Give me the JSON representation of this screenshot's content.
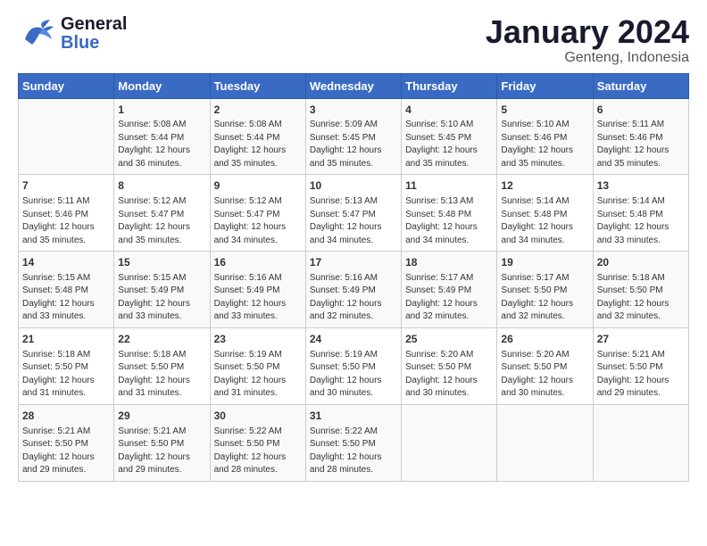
{
  "header": {
    "logo_general": "General",
    "logo_blue": "Blue",
    "title": "January 2024",
    "subtitle": "Genteng, Indonesia"
  },
  "weekdays": [
    "Sunday",
    "Monday",
    "Tuesday",
    "Wednesday",
    "Thursday",
    "Friday",
    "Saturday"
  ],
  "weeks": [
    [
      {
        "day": "",
        "info": ""
      },
      {
        "day": "1",
        "info": "Sunrise: 5:08 AM\nSunset: 5:44 PM\nDaylight: 12 hours\nand 36 minutes."
      },
      {
        "day": "2",
        "info": "Sunrise: 5:08 AM\nSunset: 5:44 PM\nDaylight: 12 hours\nand 35 minutes."
      },
      {
        "day": "3",
        "info": "Sunrise: 5:09 AM\nSunset: 5:45 PM\nDaylight: 12 hours\nand 35 minutes."
      },
      {
        "day": "4",
        "info": "Sunrise: 5:10 AM\nSunset: 5:45 PM\nDaylight: 12 hours\nand 35 minutes."
      },
      {
        "day": "5",
        "info": "Sunrise: 5:10 AM\nSunset: 5:46 PM\nDaylight: 12 hours\nand 35 minutes."
      },
      {
        "day": "6",
        "info": "Sunrise: 5:11 AM\nSunset: 5:46 PM\nDaylight: 12 hours\nand 35 minutes."
      }
    ],
    [
      {
        "day": "7",
        "info": "Sunrise: 5:11 AM\nSunset: 5:46 PM\nDaylight: 12 hours\nand 35 minutes."
      },
      {
        "day": "8",
        "info": "Sunrise: 5:12 AM\nSunset: 5:47 PM\nDaylight: 12 hours\nand 35 minutes."
      },
      {
        "day": "9",
        "info": "Sunrise: 5:12 AM\nSunset: 5:47 PM\nDaylight: 12 hours\nand 34 minutes."
      },
      {
        "day": "10",
        "info": "Sunrise: 5:13 AM\nSunset: 5:47 PM\nDaylight: 12 hours\nand 34 minutes."
      },
      {
        "day": "11",
        "info": "Sunrise: 5:13 AM\nSunset: 5:48 PM\nDaylight: 12 hours\nand 34 minutes."
      },
      {
        "day": "12",
        "info": "Sunrise: 5:14 AM\nSunset: 5:48 PM\nDaylight: 12 hours\nand 34 minutes."
      },
      {
        "day": "13",
        "info": "Sunrise: 5:14 AM\nSunset: 5:48 PM\nDaylight: 12 hours\nand 33 minutes."
      }
    ],
    [
      {
        "day": "14",
        "info": "Sunrise: 5:15 AM\nSunset: 5:48 PM\nDaylight: 12 hours\nand 33 minutes."
      },
      {
        "day": "15",
        "info": "Sunrise: 5:15 AM\nSunset: 5:49 PM\nDaylight: 12 hours\nand 33 minutes."
      },
      {
        "day": "16",
        "info": "Sunrise: 5:16 AM\nSunset: 5:49 PM\nDaylight: 12 hours\nand 33 minutes."
      },
      {
        "day": "17",
        "info": "Sunrise: 5:16 AM\nSunset: 5:49 PM\nDaylight: 12 hours\nand 32 minutes."
      },
      {
        "day": "18",
        "info": "Sunrise: 5:17 AM\nSunset: 5:49 PM\nDaylight: 12 hours\nand 32 minutes."
      },
      {
        "day": "19",
        "info": "Sunrise: 5:17 AM\nSunset: 5:50 PM\nDaylight: 12 hours\nand 32 minutes."
      },
      {
        "day": "20",
        "info": "Sunrise: 5:18 AM\nSunset: 5:50 PM\nDaylight: 12 hours\nand 32 minutes."
      }
    ],
    [
      {
        "day": "21",
        "info": "Sunrise: 5:18 AM\nSunset: 5:50 PM\nDaylight: 12 hours\nand 31 minutes."
      },
      {
        "day": "22",
        "info": "Sunrise: 5:18 AM\nSunset: 5:50 PM\nDaylight: 12 hours\nand 31 minutes."
      },
      {
        "day": "23",
        "info": "Sunrise: 5:19 AM\nSunset: 5:50 PM\nDaylight: 12 hours\nand 31 minutes."
      },
      {
        "day": "24",
        "info": "Sunrise: 5:19 AM\nSunset: 5:50 PM\nDaylight: 12 hours\nand 30 minutes."
      },
      {
        "day": "25",
        "info": "Sunrise: 5:20 AM\nSunset: 5:50 PM\nDaylight: 12 hours\nand 30 minutes."
      },
      {
        "day": "26",
        "info": "Sunrise: 5:20 AM\nSunset: 5:50 PM\nDaylight: 12 hours\nand 30 minutes."
      },
      {
        "day": "27",
        "info": "Sunrise: 5:21 AM\nSunset: 5:50 PM\nDaylight: 12 hours\nand 29 minutes."
      }
    ],
    [
      {
        "day": "28",
        "info": "Sunrise: 5:21 AM\nSunset: 5:50 PM\nDaylight: 12 hours\nand 29 minutes."
      },
      {
        "day": "29",
        "info": "Sunrise: 5:21 AM\nSunset: 5:50 PM\nDaylight: 12 hours\nand 29 minutes."
      },
      {
        "day": "30",
        "info": "Sunrise: 5:22 AM\nSunset: 5:50 PM\nDaylight: 12 hours\nand 28 minutes."
      },
      {
        "day": "31",
        "info": "Sunrise: 5:22 AM\nSunset: 5:50 PM\nDaylight: 12 hours\nand 28 minutes."
      },
      {
        "day": "",
        "info": ""
      },
      {
        "day": "",
        "info": ""
      },
      {
        "day": "",
        "info": ""
      }
    ]
  ]
}
